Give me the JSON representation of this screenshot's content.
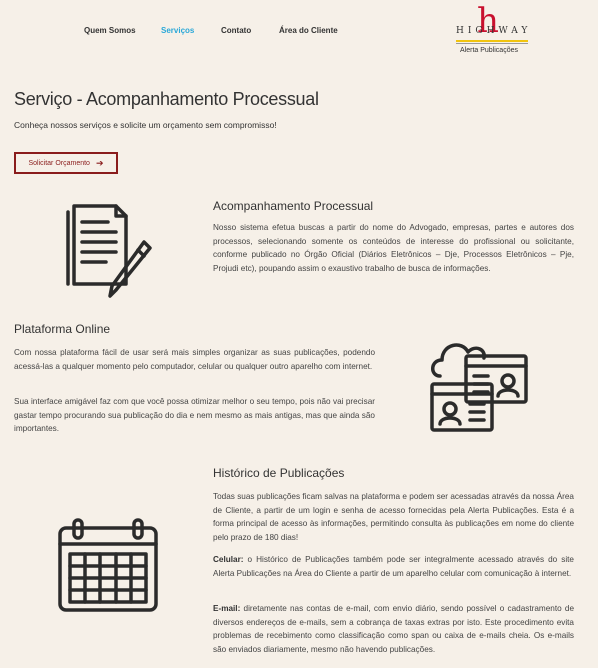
{
  "nav": {
    "items": [
      "Quem Somos",
      "Serviços",
      "Contato",
      "Área do Cliente"
    ]
  },
  "logo": {
    "word": "HIGHWAY",
    "tagline": "Alerta Publicações"
  },
  "page": {
    "title": "Serviço - Acompanhamento Processual",
    "subtitle": "Conheça nossos serviços e solicite um orçamento sem compromisso!",
    "cta_label": "Solicitar Orçamento"
  },
  "sections": {
    "acompanhamento": {
      "title": "Acompanhamento Processual",
      "text": "Nosso sistema efetua buscas a partir do nome do Advogado, empresas, partes e autores dos processos, selecionando somente os conteúdos de interesse do profissional ou solicitante, conforme publicado no Órgão Oficial (Diários Eletrônicos – Dje, Processos Eletrônicos – Pje, Projudi etc), poupando assim o exaustivo trabalho de busca de informações."
    },
    "plataforma": {
      "title": "Plataforma Online",
      "text1": "Com nossa plataforma fácil de usar será mais simples organizar as suas publicações, podendo acessá-las a qualquer momento pelo computador, celular ou qualquer outro aparelho com internet.",
      "text2": "Sua interface amigável faz com que você possa otimizar melhor o seu tempo, pois não vai precisar gastar tempo procurando sua publicação do dia e nem mesmo as mais antigas, mas que ainda são importantes."
    },
    "historico": {
      "title": "Histórico de Publicações",
      "text1": "Todas suas publicações ficam salvas na plataforma e podem ser acessadas através da nossa Área de Cliente, a partir de um login e senha de acesso fornecidas pela Alerta Publicações. Esta é a forma principal de acesso às informações, permitindo consulta às publicações em nome do cliente pelo prazo de 180 dias!",
      "celular_label": "Celular:",
      "celular_text": " o Histórico de Publicações também pode ser integralmente acessado através do site Alerta Publicações na Área do Cliente a partir de um aparelho celular com comunicação à internet.",
      "email_label": "E-mail:",
      "email_text": " diretamente nas contas de e-mail, com envio diário, sendo possível o cadastramento de diversos endereços de e-mails, sem a cobrança de taxas extras por isto. Este procedimento evita problemas de recebimento como classificação como span ou caixa de e-mails cheia. Os e-mails são enviados diariamente, mesmo não havendo publicações."
    }
  },
  "colors": {
    "background": "#f6f0e8",
    "nav_active": "#2aa8d8",
    "button_border": "#8a1c1c",
    "logo_accent": "#c8102e"
  },
  "icons": [
    "documents-pencil-icon",
    "cloud-profiles-icon",
    "calendar-icon"
  ]
}
